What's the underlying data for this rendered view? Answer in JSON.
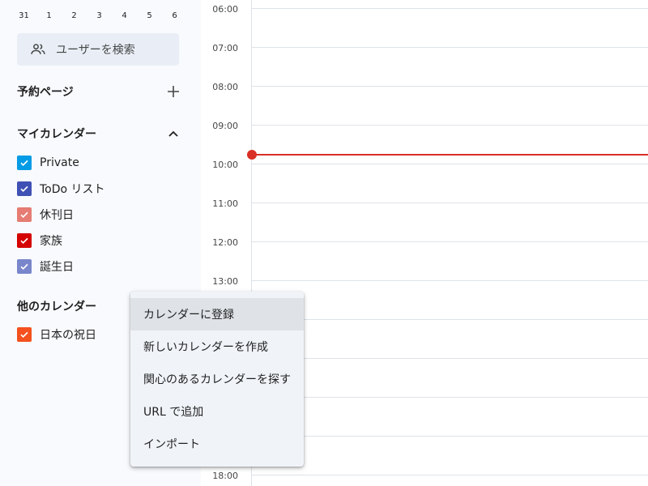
{
  "mini_calendar": {
    "days": [
      "31",
      "1",
      "2",
      "3",
      "4",
      "5",
      "6"
    ]
  },
  "search_users": {
    "icon": "people-icon",
    "label": "ユーザーを検索"
  },
  "booking_pages": {
    "title": "予約ページ",
    "action_icon": "plus-icon"
  },
  "my_calendars": {
    "title": "マイカレンダー",
    "toggle_icon": "chevron-up-icon",
    "items": [
      {
        "name": "Private",
        "color": "#039be5"
      },
      {
        "name": "ToDo リスト",
        "color": "#3f51b5"
      },
      {
        "name": "休刊日",
        "color": "#e67c73"
      },
      {
        "name": "家族",
        "color": "#d50000"
      },
      {
        "name": "誕生日",
        "color": "#7986cb"
      }
    ]
  },
  "other_calendars": {
    "title": "他のカレンダー",
    "items": [
      {
        "name": "日本の祝日",
        "color": "#f4511e"
      }
    ]
  },
  "timeline": {
    "hours": [
      "06:00",
      "07:00",
      "08:00",
      "09:00",
      "10:00",
      "11:00",
      "12:00",
      "13:00",
      "18:00"
    ],
    "now_color": "#d93025"
  },
  "menu": {
    "items": [
      {
        "label": "カレンダーに登録"
      },
      {
        "label": "新しいカレンダーを作成"
      },
      {
        "label": "関心のあるカレンダーを探す"
      },
      {
        "label": "URL で追加"
      },
      {
        "label": "インポート"
      }
    ]
  }
}
